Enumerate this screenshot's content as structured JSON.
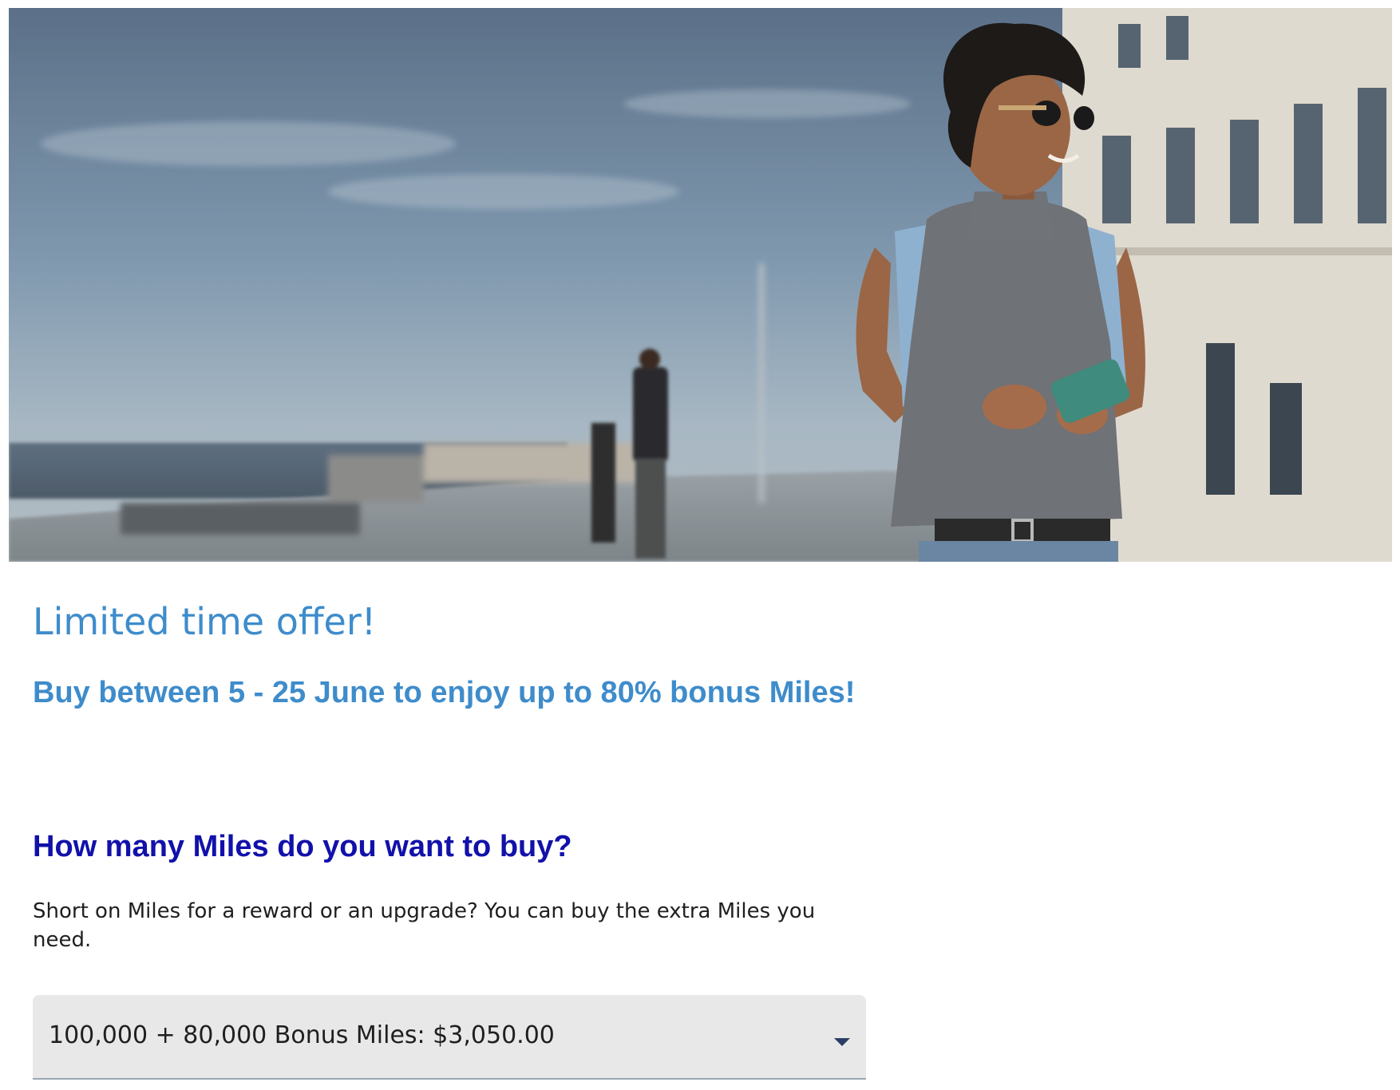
{
  "hero": {
    "image_description": "traveller-photo"
  },
  "offer": {
    "title": "Limited time offer!",
    "subtitle": "Buy between 5 - 25 June to enjoy up to 80% bonus Miles!"
  },
  "buy": {
    "title": "How many Miles do you want to buy?",
    "description": "Short on Miles for a reward or an upgrade? You can buy the extra Miles you need.",
    "select": {
      "selected_value": "100,000 + 80,000 Bonus Miles: $3,050.00",
      "icon": "chevron-down-icon"
    }
  },
  "colors": {
    "offer_blue": "#3e8ccb",
    "heading_blue": "#1111aa",
    "select_bg": "#e8e8e8"
  }
}
